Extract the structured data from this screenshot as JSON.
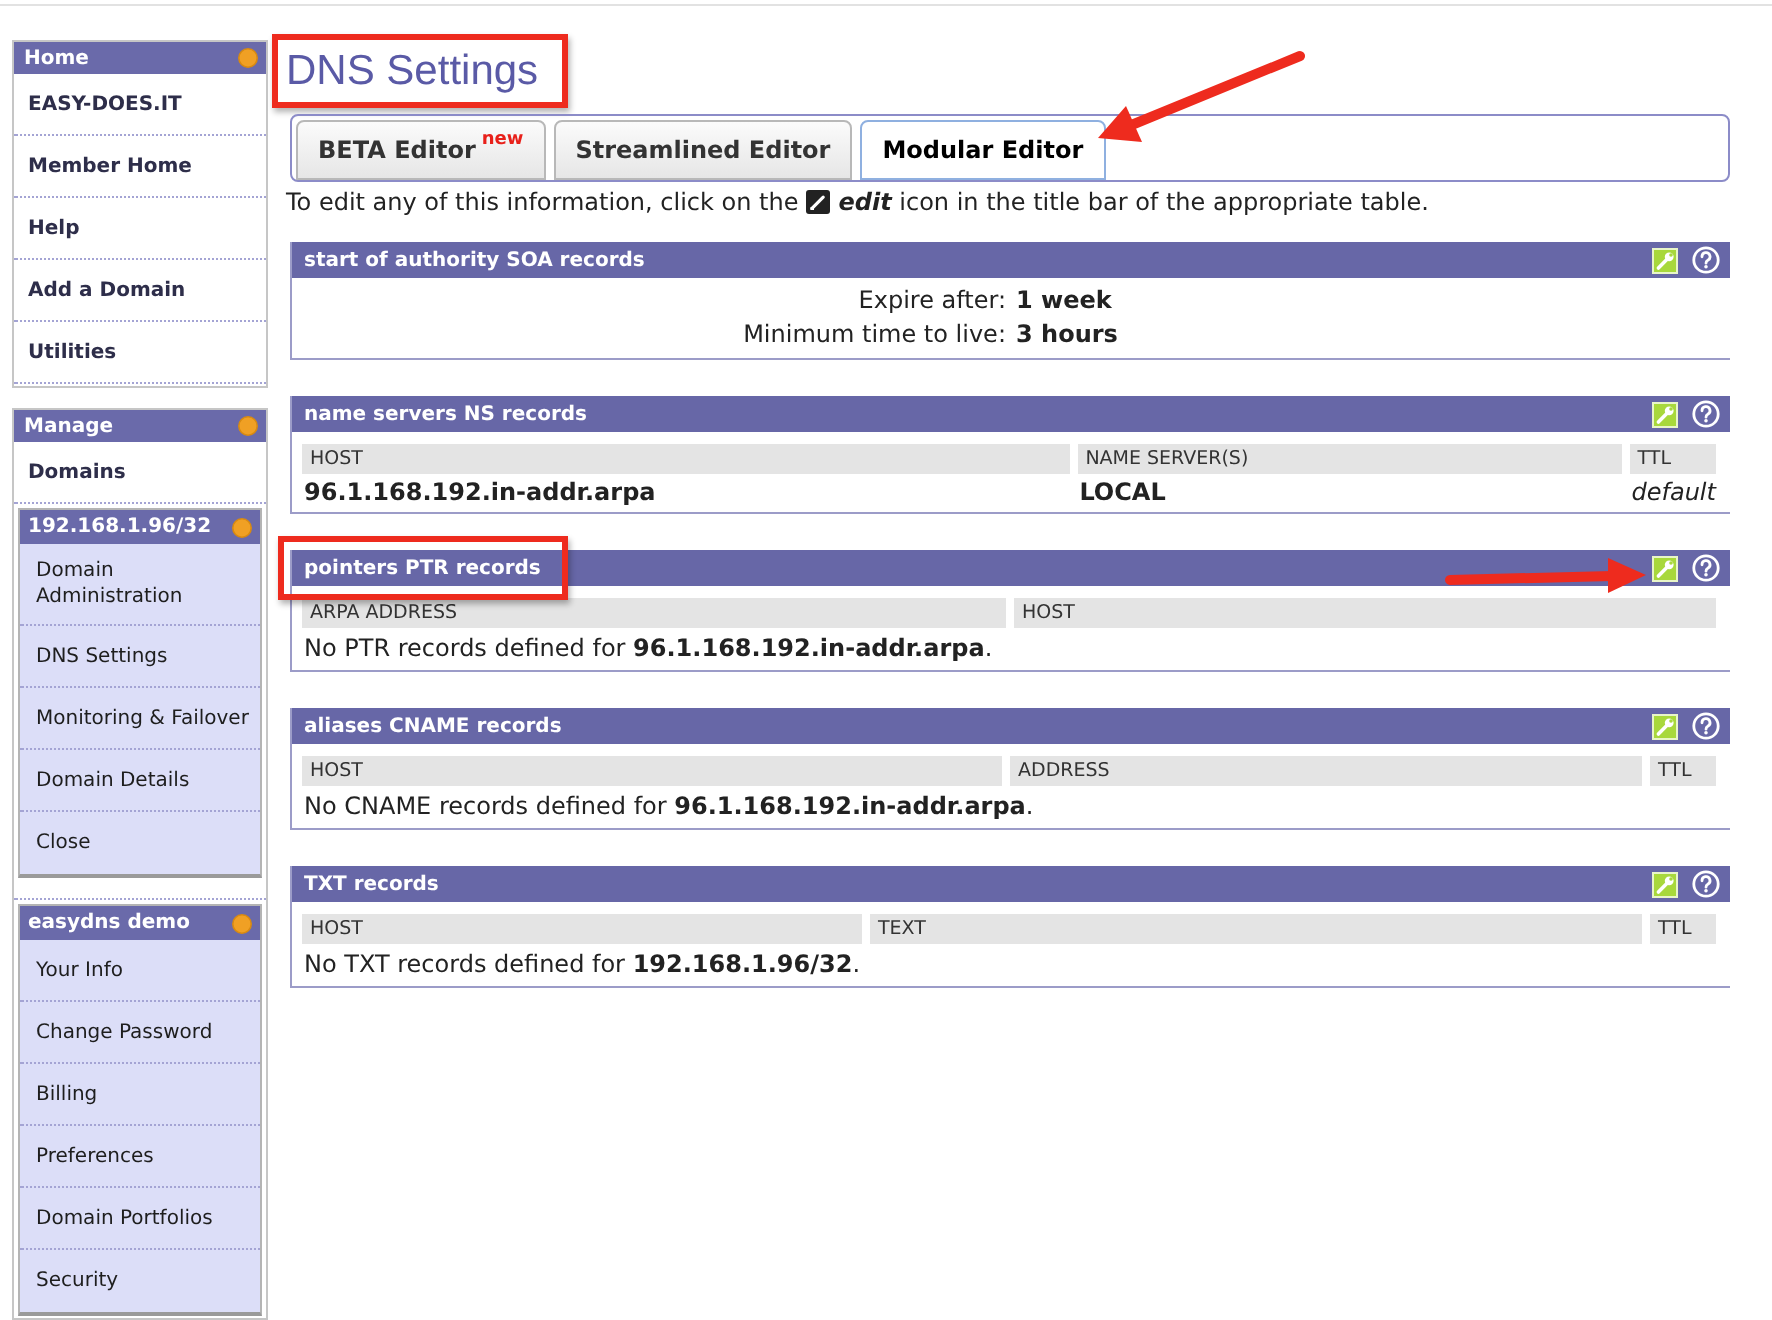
{
  "page": {
    "title": "DNS Settings"
  },
  "sidebar": [
    {
      "title": "Home",
      "items": [
        "EASY-DOES.IT",
        "Member Home",
        "Help",
        "Add a Domain",
        "Utilities"
      ]
    },
    {
      "title": "Manage",
      "items": [
        "Domains"
      ],
      "subsections": [
        {
          "title": "192.168.1.96/32",
          "items": [
            "Domain Administration",
            "DNS Settings",
            "Monitoring & Failover",
            "Domain Details",
            "Close"
          ]
        },
        {
          "title": "easydns demo",
          "items": [
            "Your Info",
            "Change Password",
            "Billing",
            "Preferences",
            "Domain Portfolios",
            "Security"
          ]
        }
      ]
    }
  ],
  "tabs": [
    {
      "label": "BETA Editor",
      "badge": "new",
      "selected": false
    },
    {
      "label": "Streamlined Editor",
      "selected": false
    },
    {
      "label": "Modular Editor",
      "selected": true
    }
  ],
  "instruction": {
    "before": "To edit any of this information, click on the",
    "after": "**edit** icon in the title bar of the appropriate table."
  },
  "panels": [
    {
      "kind": "summary",
      "title": "start of authority SOA records",
      "fields": [
        {
          "label": "Expire after:",
          "value": "1 week"
        },
        {
          "label": "Minimum time to live:",
          "value": "3 hours"
        }
      ]
    },
    {
      "kind": "table",
      "title": "name servers NS records",
      "columns": [
        "HOST",
        "NAME SERVER(S)",
        "TTL"
      ],
      "rows": [
        [
          "96.1.168.192.in-addr.arpa",
          "LOCAL",
          "default"
        ]
      ]
    },
    {
      "kind": "table",
      "title": "pointers PTR records",
      "columns": [
        "ARPA ADDRESS",
        "HOST"
      ],
      "message": "No PTR records defined for **96.1.168.192.in-addr.arpa**."
    },
    {
      "kind": "table",
      "title": "aliases CNAME records",
      "columns": [
        "HOST",
        "ADDRESS",
        "TTL"
      ],
      "message": "No CNAME records defined for **96.1.168.192.in-addr.arpa**."
    },
    {
      "kind": "table",
      "title": "TXT records",
      "columns": [
        "HOST",
        "TEXT",
        "TTL"
      ],
      "message": "No TXT records defined for **192.168.1.96/32**."
    }
  ]
}
